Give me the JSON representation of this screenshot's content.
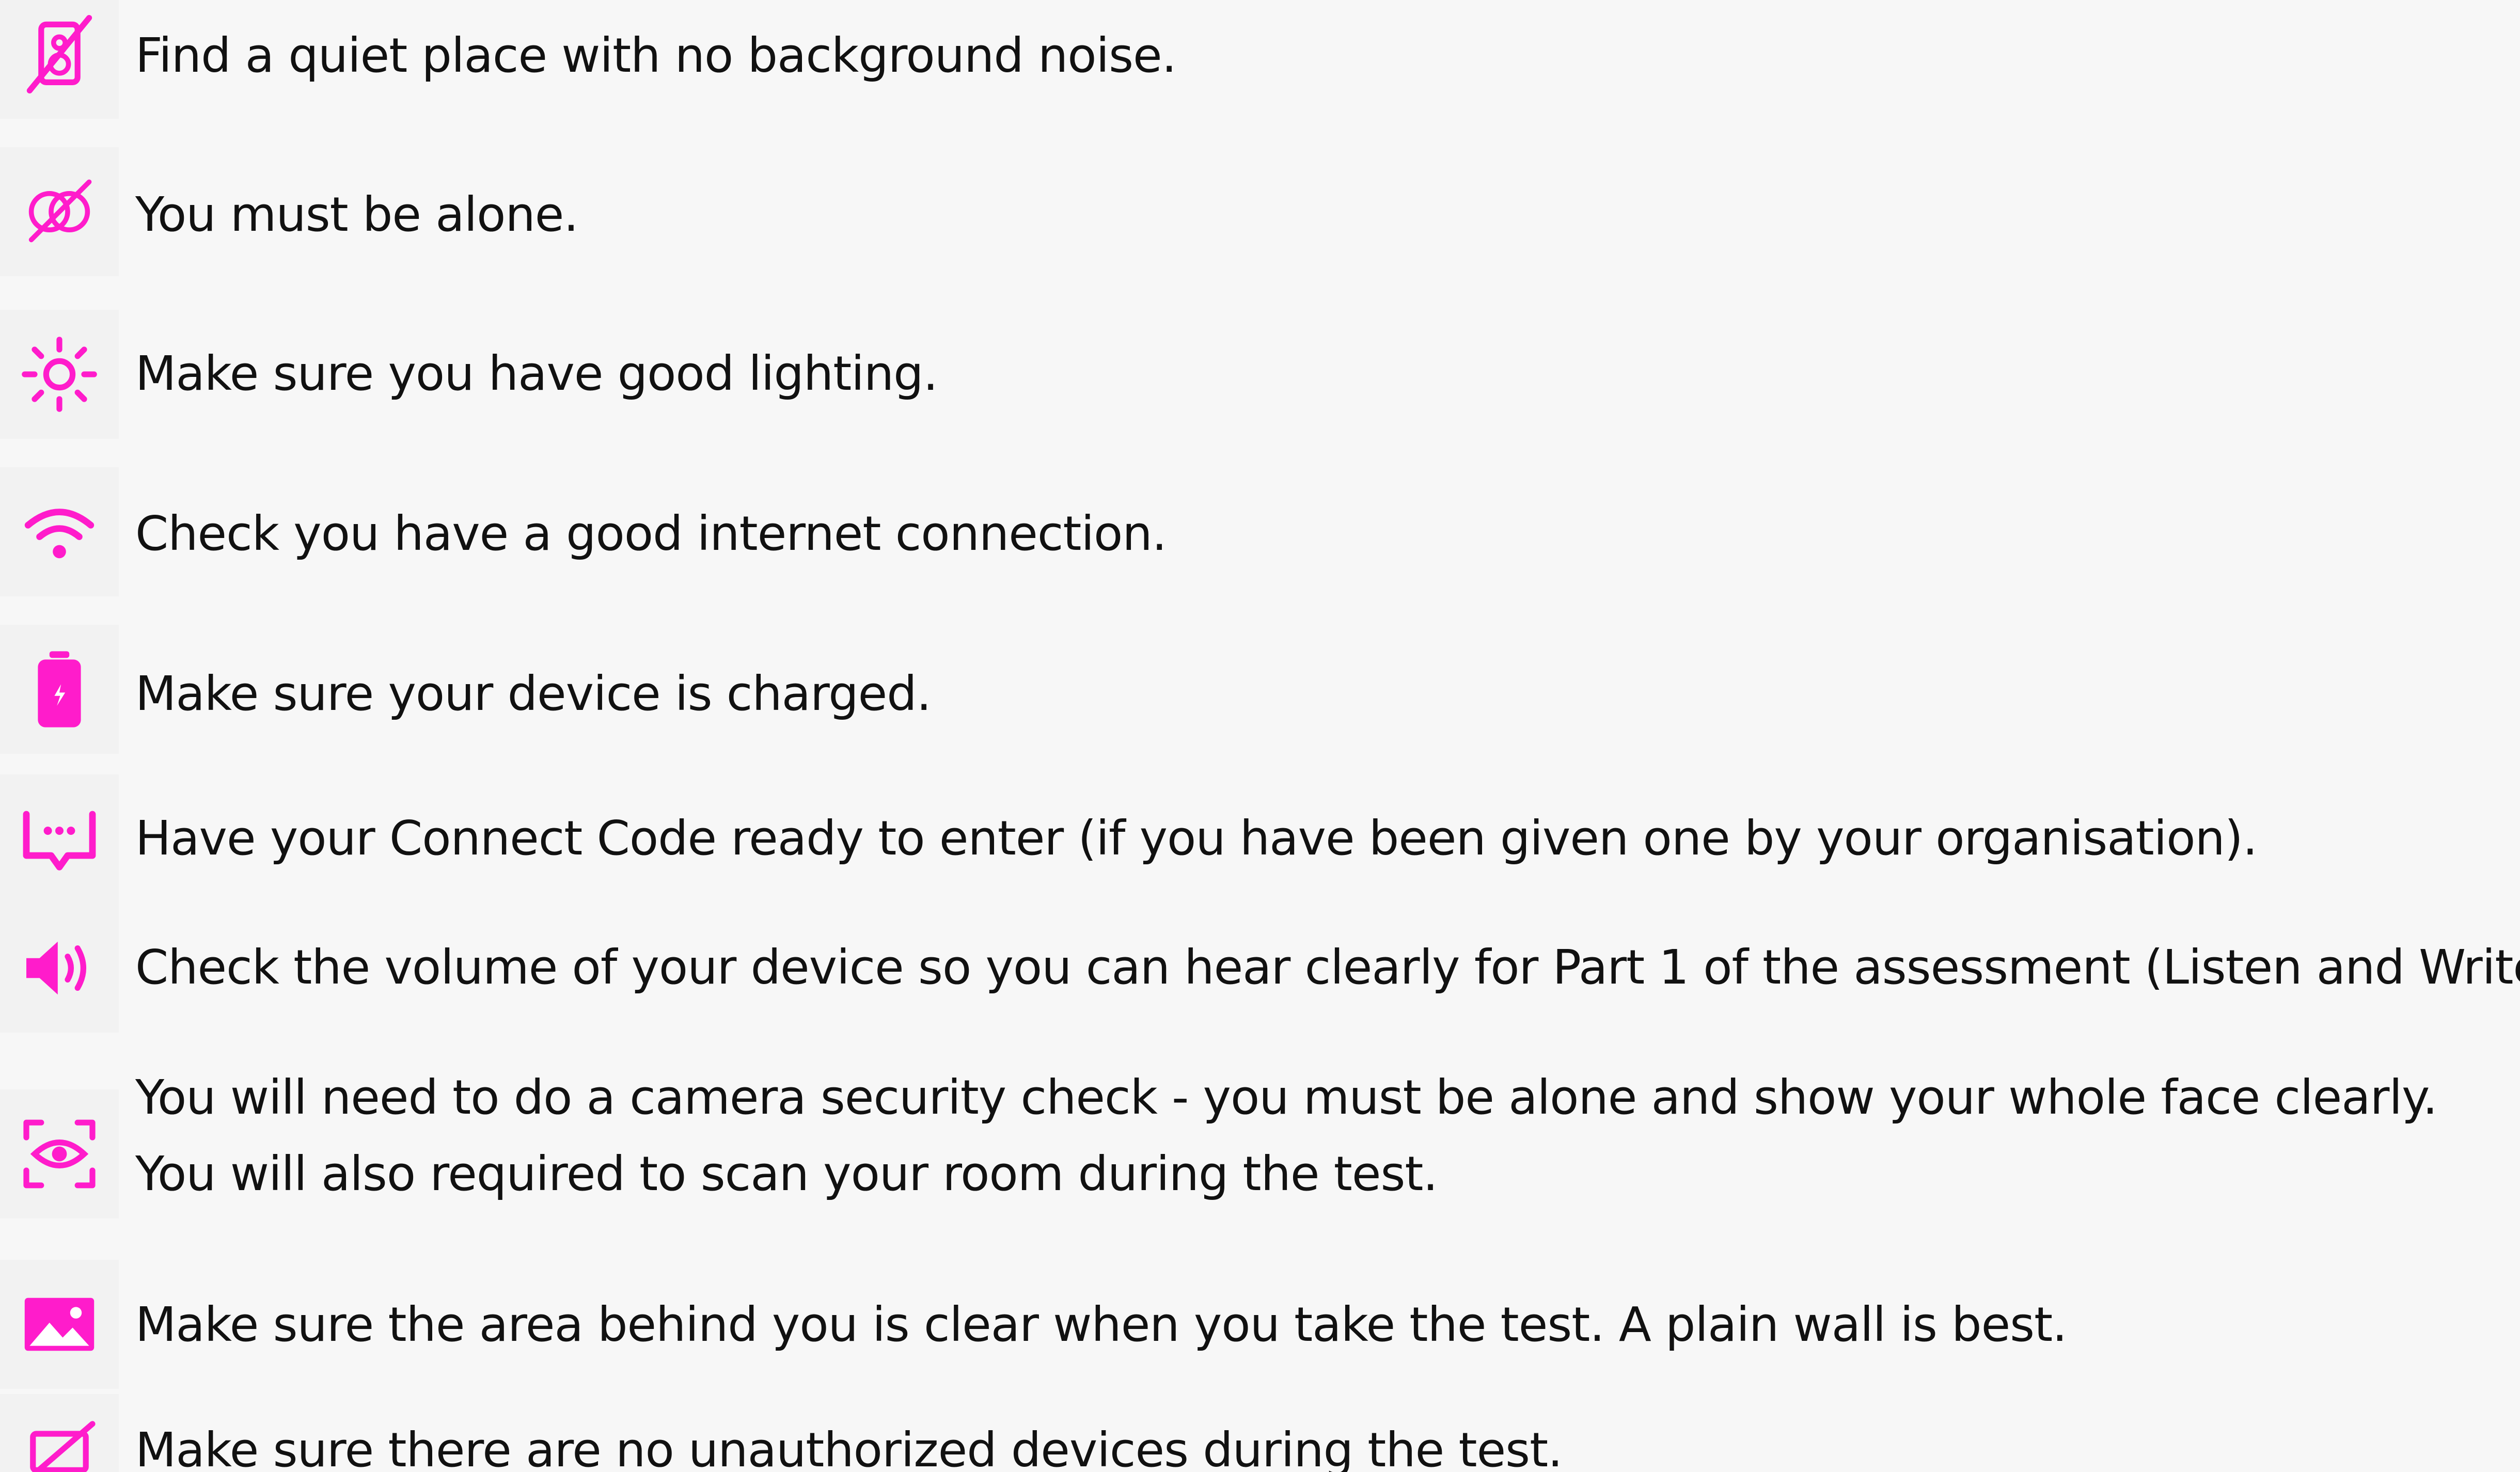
{
  "accent_color": "#ff1ccb",
  "requirements": [
    {
      "icon": "speaker-slash-icon",
      "text": "Find a quiet place with no background noise."
    },
    {
      "icon": "people-slash-icon",
      "text": "You must be alone."
    },
    {
      "icon": "sun-icon",
      "text": "Make sure you have good lighting."
    },
    {
      "icon": "wifi-icon",
      "text": "Check you have a good internet connection."
    },
    {
      "icon": "battery-charging-icon",
      "text": "Make sure your device is charged."
    },
    {
      "icon": "code-bubble-icon",
      "text": "Have your Connect Code ready to enter (if you have been given one by your organisation)."
    },
    {
      "icon": "volume-icon",
      "text": "Check the volume of your device so you can hear clearly for Part 1 of the assessment (Listen and Write)"
    },
    {
      "icon": "eye-scan-icon",
      "text_line1": "You will need to do a camera security check - you must be alone and show your whole face clearly.",
      "text_line2": "You will also required to scan your room during the test."
    },
    {
      "icon": "image-icon",
      "text": "Make sure the area behind you is clear when you take the test. A plain wall is best."
    },
    {
      "icon": "laptop-slash-icon",
      "text": "Make sure there are no unauthorized devices during the test."
    }
  ]
}
